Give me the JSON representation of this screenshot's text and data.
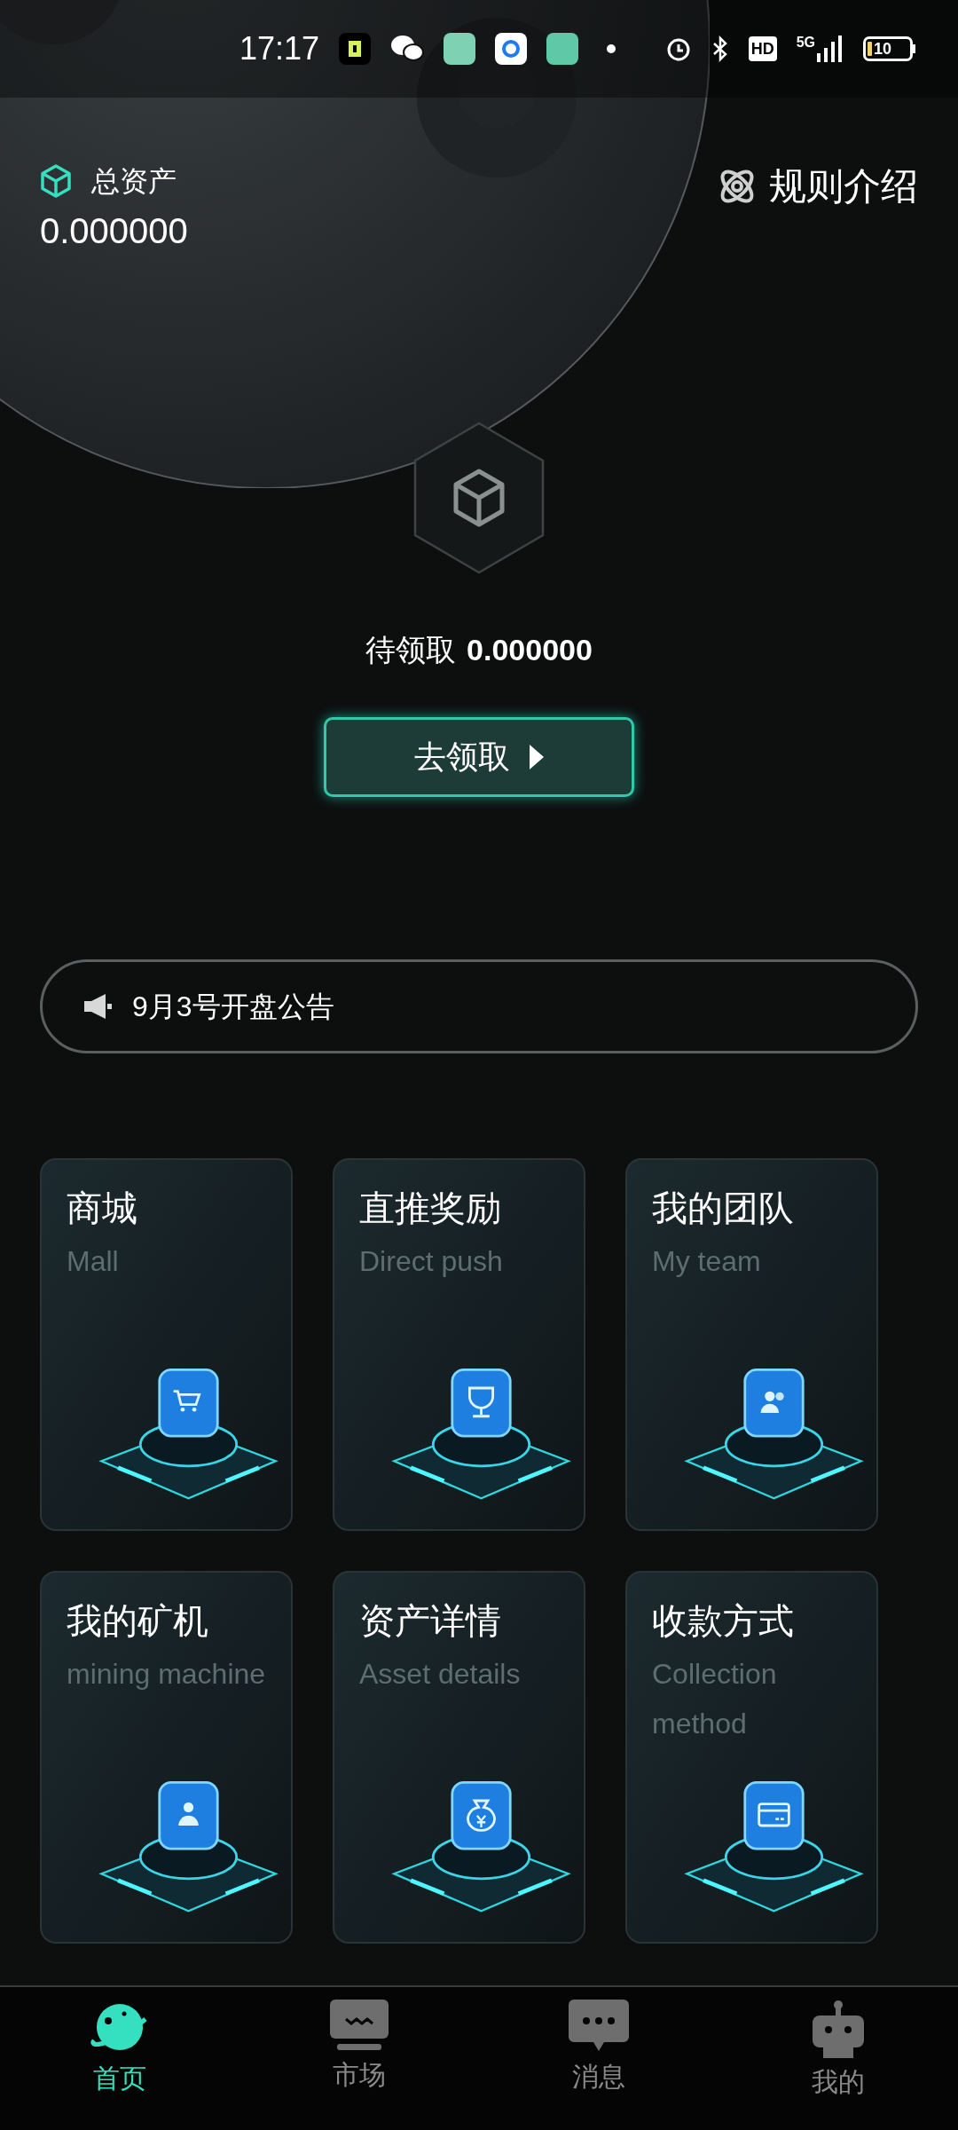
{
  "status_bar": {
    "time": "17:17",
    "network": "5G",
    "hd": "HD",
    "battery": "10"
  },
  "header": {
    "label": "总资产",
    "value": "0.000000",
    "rules_link": "规则介绍"
  },
  "pending": {
    "label": "待领取",
    "value": "0.000000"
  },
  "claim_button": {
    "label": "去领取"
  },
  "announcement": {
    "text": "9月3号开盘公告"
  },
  "cards": [
    {
      "title": "商城",
      "subtitle": "Mall"
    },
    {
      "title": "直推奖励",
      "subtitle": "Direct push"
    },
    {
      "title": "我的团队",
      "subtitle": "My team"
    },
    {
      "title": "我的矿机",
      "subtitle": "mining machine"
    },
    {
      "title": "资产详情",
      "subtitle": "Asset details"
    },
    {
      "title": "收款方式",
      "subtitle": "Collection method"
    }
  ],
  "bottom_nav": [
    {
      "label": "首页",
      "selected": true
    },
    {
      "label": "市场",
      "selected": false
    },
    {
      "label": "消息",
      "selected": false
    },
    {
      "label": "我的",
      "selected": false
    }
  ]
}
